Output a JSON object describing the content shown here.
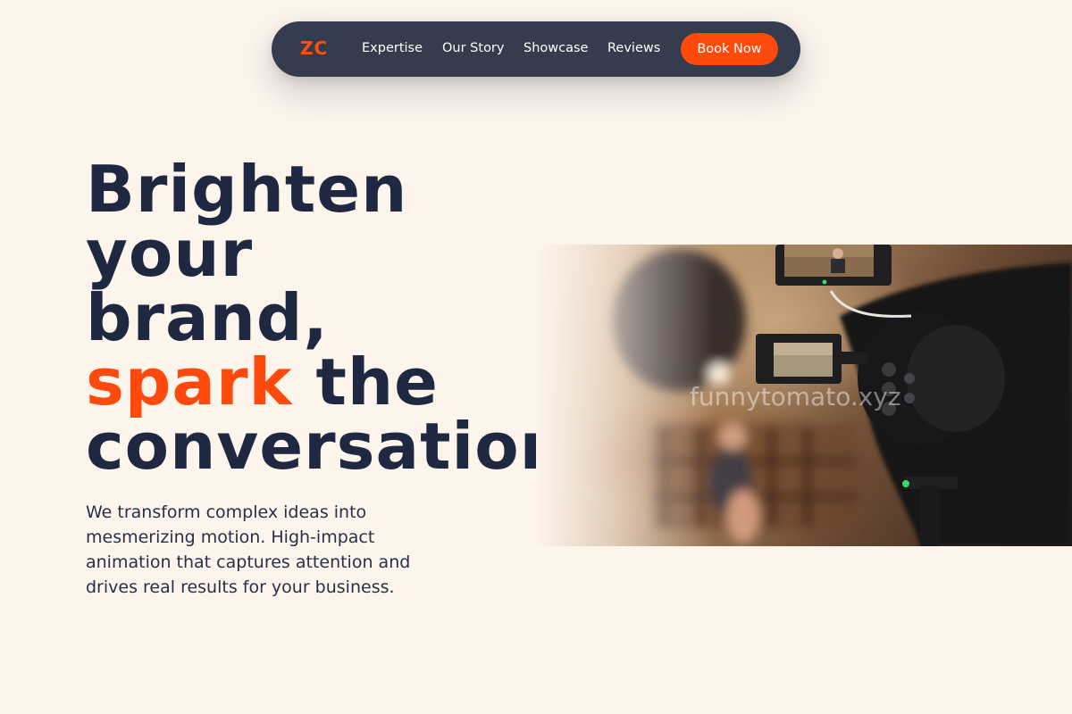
{
  "nav": {
    "logo": "ZC",
    "links": [
      "Expertise",
      "Our Story",
      "Showcase",
      "Reviews"
    ],
    "cta": "Book Now"
  },
  "hero": {
    "headline": {
      "line1": "Brighten",
      "line2": "your",
      "line3": "brand,",
      "line4_accent": "spark",
      "line4_rest": " the",
      "line5": "conversation."
    },
    "subtitle": "We transform complex ideas into mesmerizing motion. High-impact animation that captures attention and drives real results for your business.",
    "image": {
      "watermark": "funnytomato.xyz"
    }
  },
  "colors": {
    "background": "#fdf4ec",
    "nav": "#343c4e",
    "accent": "#ff4a0d",
    "text": "#1e2840"
  }
}
